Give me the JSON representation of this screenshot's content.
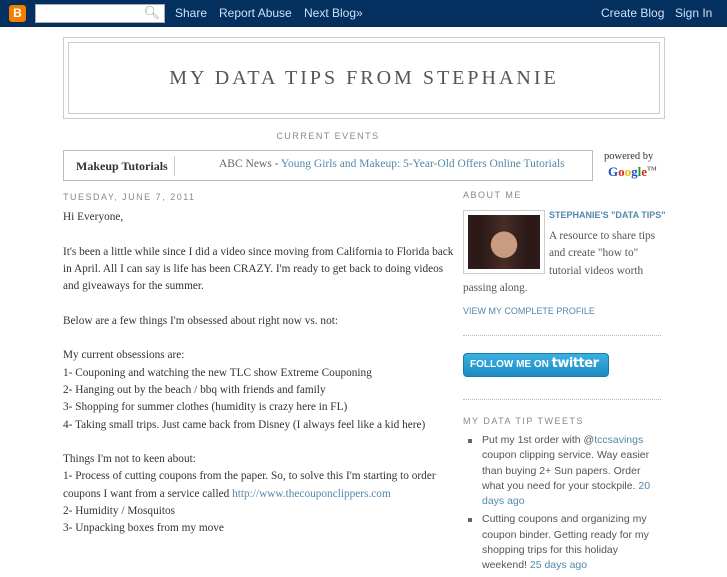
{
  "navbar": {
    "search_placeholder": "",
    "share": "Share",
    "report": "Report Abuse",
    "next": "Next Blog»",
    "create": "Create Blog",
    "signin": "Sign In",
    "logo": "B"
  },
  "blog_title": "MY DATA TIPS FROM STEPHANIE",
  "current_events": {
    "heading": "CURRENT EVENTS",
    "topic": "Makeup Tutorials",
    "source": "ABC News - ",
    "headline": "Young Girls and Makeup: 5-Year-Old Offers Online Tutorials",
    "powered_by": "powered by",
    "google": "Google",
    "tm": "TM"
  },
  "post": {
    "date": "TUESDAY, JUNE 7, 2011",
    "lines": [
      "Hi Everyone,",
      "",
      "It's been a little while since I did a video since moving from California to Florida back",
      "in April. All I can say is life has been CRAZY. I'm ready to get back to doing videos",
      "and giveaways for the summer.",
      "",
      "Below are a few things I'm obsessed about right now vs. not:",
      "",
      "My current obsessions are:",
      "1- Couponing and watching the new TLC show Extreme Couponing",
      "2- Hanging out by the beach / bbq with friends and family",
      "3- Shopping for summer clothes (humidity is crazy here in FL)",
      "4- Taking small trips. Just came back from Disney (I always feel like a kid here)",
      "",
      "Things I'm not to keen about:",
      "1- Process of cutting coupons from the paper. So, to solve this I'm starting to order"
    ],
    "line_coupons": "coupons I want from a service called ",
    "link": "http://www.thecouponclippers.com",
    "tail": [
      "2- Humidity / Mosquitos",
      "3- Unpacking boxes from my move"
    ]
  },
  "sidebar": {
    "about_heading": "ABOUT ME",
    "profile_name": "STEPHANIE'S \"DATA TIPS\"",
    "desc": [
      "A resource to share tips",
      "and create \"how to\"",
      "tutorial videos worth"
    ],
    "desc_last": "passing along.",
    "view_profile": "VIEW MY COMPLETE PROFILE",
    "twitter": {
      "label": "FOLLOW ME ON ",
      "brand": "twitter"
    },
    "tweets_heading": "MY DATA TIP TWEETS",
    "tweets": [
      {
        "pre": "Put my 1st order with @",
        "handle": "tccsavings",
        "text": " coupon clipping service. Way easier than buying 2+ Sun papers. Order what you need for your stockpile. ",
        "time": "20 days ago"
      },
      {
        "pre": "",
        "handle": "",
        "text": "Cutting coupons and organizing my coupon binder. Getting ready for my shopping trips for this holiday weekend! ",
        "time": "25 days ago"
      }
    ]
  }
}
